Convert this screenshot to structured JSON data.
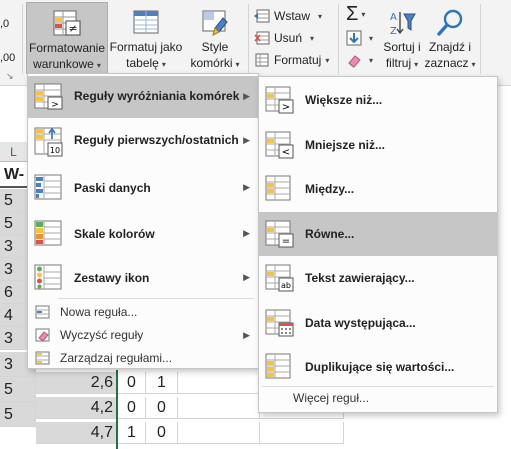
{
  "ribbon": {
    "partial_number": ",0",
    "partial_00": ",00",
    "partial_mark": "↘",
    "conditional_formatting": {
      "line1": "Formatowanie",
      "line2": "warunkowe"
    },
    "format_as_table": {
      "line1": "Formatuj jako",
      "line2": "tabelę"
    },
    "cell_styles": {
      "line1": "Style",
      "line2": "komórki"
    },
    "insert": "Wstaw",
    "delete": "Usuń",
    "format": "Formatuj",
    "sort_filter": {
      "line1": "Sortuj i",
      "line2": "filtruj"
    },
    "find_select": {
      "line1": "Znajdź i",
      "line2": "zaznacz"
    },
    "sigma": "Σ"
  },
  "sheet": {
    "col_header_left": "L",
    "row_header_partial": "W-",
    "col_a_values": [
      "5",
      "5",
      "3",
      "3",
      "6",
      "4",
      "3",
      "3",
      "5",
      "5"
    ],
    "rows": [
      {
        "b": "2,6",
        "c": "0",
        "d": "1"
      },
      {
        "b": "4,2",
        "c": "0",
        "d": "0"
      },
      {
        "b": "4,7",
        "c": "1",
        "d": "0"
      }
    ]
  },
  "main_menu": {
    "items": [
      {
        "label": "Reguły wyróżniania komórek",
        "has_submenu": true,
        "highlighted": true
      },
      {
        "label": "Reguły pierwszych/ostatnich",
        "has_submenu": true,
        "highlighted": false
      },
      {
        "label": "Paski danych",
        "has_submenu": true,
        "highlighted": false
      },
      {
        "label": "Skale kolorów",
        "has_submenu": true,
        "highlighted": false
      },
      {
        "label": "Zestawy ikon",
        "has_submenu": true,
        "highlighted": false
      }
    ],
    "small_items": [
      {
        "label": "Nowa reguła...",
        "has_submenu": false
      },
      {
        "label": "Wyczyść reguły",
        "has_submenu": true
      },
      {
        "label": "Zarządzaj regułami...",
        "has_submenu": false
      }
    ]
  },
  "sub_menu": {
    "items": [
      {
        "label": "Większe niż...",
        "highlighted": false
      },
      {
        "label": "Mniejsze niż...",
        "highlighted": false
      },
      {
        "label": "Między...",
        "highlighted": false
      },
      {
        "label": "Równe...",
        "highlighted": true
      },
      {
        "label": "Tekst zawierający...",
        "highlighted": false
      },
      {
        "label": "Data występująca...",
        "highlighted": false
      },
      {
        "label": "Duplikujące się wartości...",
        "highlighted": false
      }
    ],
    "more_rules": "Więcej reguł..."
  },
  "icons": {
    "gt_symbol": ">",
    "lt_symbol": "<",
    "eq_symbol": "=",
    "ab_text": "ab",
    "top_number": "10",
    "neq_symbol": "≠"
  },
  "colors": {
    "highlight": "#c6c6c6",
    "ribbon_bg": "#f3f3f3",
    "cell_gray": "#d9d9d9",
    "bar_yellow": "#f5c242",
    "bar_blue": "#4e7fc1",
    "bar_red": "#d9534f",
    "bar_green": "#5cae5c",
    "accent_blue": "#2e75b6"
  }
}
